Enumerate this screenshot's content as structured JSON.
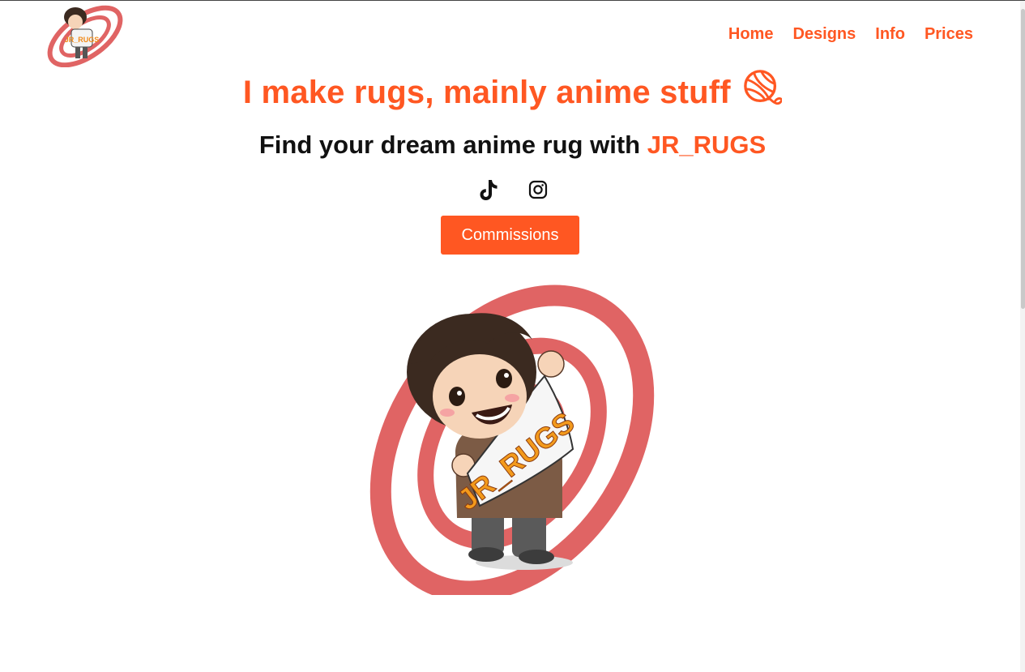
{
  "header": {
    "logo_icon": "jr-rugs-mascot-logo-icon",
    "nav": [
      {
        "label": "Home"
      },
      {
        "label": "Designs"
      },
      {
        "label": "Info"
      },
      {
        "label": "Prices"
      }
    ]
  },
  "hero": {
    "title": "I make rugs, mainly anime stuff",
    "title_icon": "yarn-ball-icon",
    "subtitle_prefix": "Find your dream anime rug with ",
    "subtitle_brand": "JR_RUGS",
    "socials": [
      {
        "icon": "tiktok-icon"
      },
      {
        "icon": "instagram-icon"
      }
    ],
    "cta_label": "Commissions",
    "illustration": "jr-rugs-mascot-illustration",
    "rug_text": "JR_RUGS"
  },
  "colors": {
    "accent": "#ff5722",
    "ring": "#e06464",
    "text": "#111111"
  }
}
